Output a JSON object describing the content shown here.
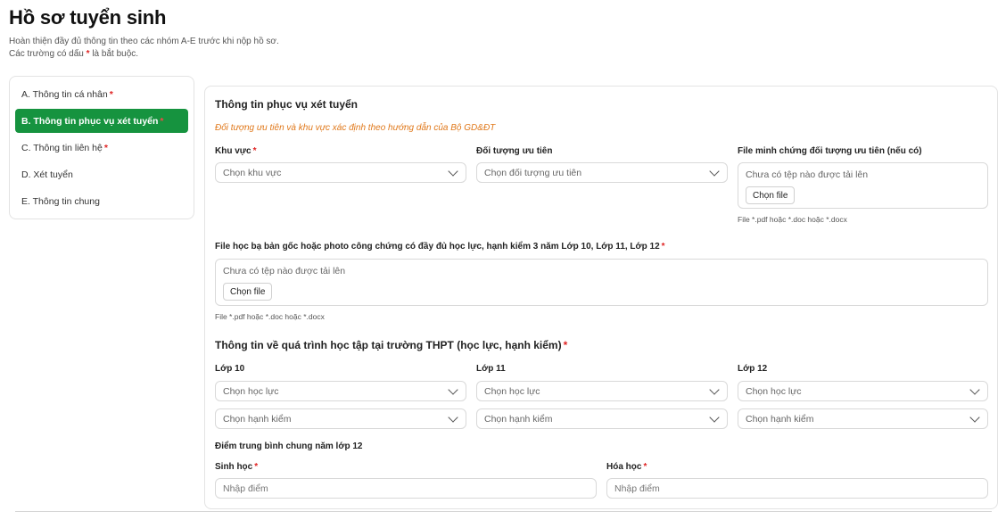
{
  "header": {
    "title": "Hồ sơ tuyển sinh",
    "desc_line1": "Hoàn thiện đầy đủ thông tin theo các nhóm A-E trước khi nộp hồ sơ.",
    "desc_line2_pre": "Các trường có dấu",
    "desc_line2_star": "*",
    "desc_line2_post": "là bắt buộc."
  },
  "sidebar": {
    "items": [
      {
        "label": "A. Thông tin cá nhân",
        "required": "*"
      },
      {
        "label": "B. Thông tin phục vụ xét tuyển",
        "required": "*",
        "active": true
      },
      {
        "label": "C. Thông tin liên hệ",
        "required": "*"
      },
      {
        "label": "D. Xét tuyển"
      },
      {
        "label": "E. Thông tin chung"
      }
    ]
  },
  "form": {
    "section_title": "Thông tin phục vụ xét tuyển",
    "note": "Đối tượng ưu tiên và khu vực xác định theo hướng dẫn của Bộ GD&ĐT",
    "khu_vuc": {
      "label": "Khu vực",
      "required": "*",
      "value": "Chọn khu vực"
    },
    "doi_tuong": {
      "label": "Đối tượng ưu tiên",
      "value": "Chọn đối tượng ưu tiên"
    },
    "file_doi_tuong": {
      "label": "File minh chứng đối tượng ưu tiên (nếu có)",
      "status": "Chưa có tệp nào được tải lên",
      "button": "Chọn file",
      "hint": "File *.pdf hoặc *.doc hoặc *.docx"
    },
    "file_hoc_ba": {
      "label": "File học bạ bản gốc hoặc photo công chứng có đầy đủ học lực, hạnh kiểm 3 năm Lớp 10, Lớp 11, Lớp 12",
      "required": "*",
      "status": "Chưa có tệp nào được tải lên",
      "button": "Chọn file",
      "hint": "File *.pdf hoặc *.doc hoặc *.docx"
    },
    "study_title": "Thông tin về quá trình học tập tại trường THPT (học lực, hạnh kiểm)",
    "study_required": "*",
    "grades": [
      {
        "label": "Lớp 10",
        "hoc_luc": "Chọn học lực",
        "hanh_kiem": "Chọn hạnh kiểm"
      },
      {
        "label": "Lớp 11",
        "hoc_luc": "Chọn học lực",
        "hanh_kiem": "Chọn hạnh kiểm"
      },
      {
        "label": "Lớp 12",
        "hoc_luc": "Chọn học lực",
        "hanh_kiem": "Chọn hạnh kiểm"
      }
    ],
    "avg_title": "Điểm trung bình chung năm lớp 12",
    "sinh_hoc": {
      "label": "Sinh học",
      "required": "*",
      "placeholder": "Nhập điểm"
    },
    "hoa_hoc": {
      "label": "Hóa học",
      "required": "*",
      "placeholder": "Nhập điểm"
    }
  },
  "colors": {
    "accent": "#16933f",
    "required": "#e02424",
    "note": "#e0781a"
  },
  "icons": {
    "select": "chevron-down-icon"
  }
}
